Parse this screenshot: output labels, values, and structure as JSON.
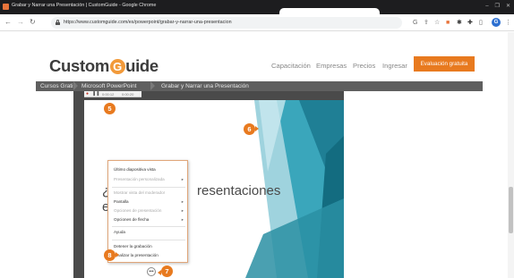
{
  "browser": {
    "window_title": "Grabar y Narrar una Presentación | CustomGuide - Google Chrome",
    "url": "https://www.customguide.com/es/powerpoint/grabar-y-narrar-una-presentacion",
    "profile_initial": "G",
    "window_controls": [
      "–",
      "❐",
      "✕"
    ]
  },
  "site": {
    "logo_left": "Custom",
    "logo_g": "G",
    "logo_right": "uide",
    "nav": [
      "Capacitación",
      "Empresas",
      "Precios",
      "Ingresar"
    ],
    "cta": "Evaluación gratuita"
  },
  "breadcrumb": [
    "Cursos Gratis",
    "Microsoft PowerPoint",
    "Grabar y Narrar una Presentación"
  ],
  "recording_toolbar": {
    "time_current": "0:00:12",
    "time_total": "0:00:20"
  },
  "slide": {
    "text_line1_left": "¿C",
    "text_line1_right": "resentaciones",
    "text_line2": "est"
  },
  "markers": [
    "5",
    "6",
    "7",
    "8"
  ],
  "context_menu": {
    "items": [
      {
        "label": "Último diapositiva vista",
        "disabled": false,
        "submenu": false
      },
      {
        "label": "Presentación personalizada",
        "disabled": true,
        "submenu": true
      },
      {
        "label": "Mostrar vista del moderador",
        "disabled": true,
        "submenu": false
      },
      {
        "label": "Pantalla",
        "disabled": false,
        "submenu": true
      },
      {
        "label": "Opciones de presentación",
        "disabled": true,
        "submenu": true
      },
      {
        "label": "Opciones de flecha",
        "disabled": false,
        "submenu": true
      },
      {
        "label": "Ayuda",
        "disabled": false,
        "submenu": false
      },
      {
        "label": "Detener la grabación",
        "disabled": false,
        "submenu": false
      },
      {
        "label": "Finalizar la presentación",
        "disabled": false,
        "submenu": false
      }
    ]
  },
  "slideshow_controls": [
    "◀",
    "▶",
    "✎",
    "▦",
    "⊕",
    "•••"
  ],
  "colors": {
    "accent": "#e87a1f",
    "teal": "#2a8fa3",
    "breadcrumb_bg": "#5f5f5f"
  }
}
